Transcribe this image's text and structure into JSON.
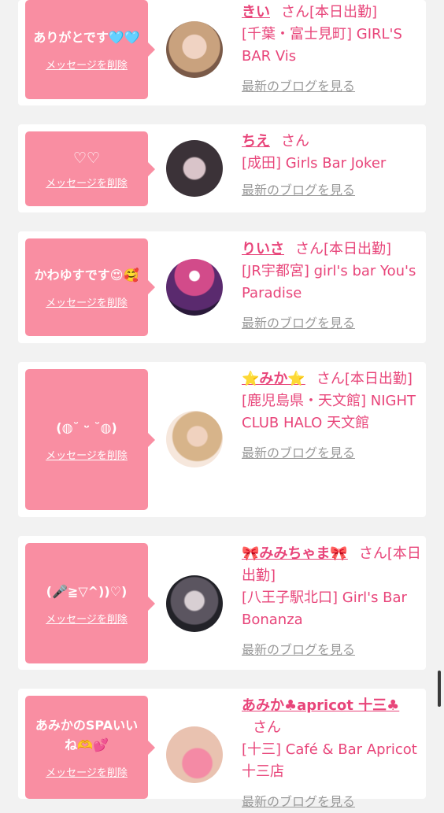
{
  "cards": [
    {
      "message": "ありがとです🩵🩵",
      "delete_label": "メッセージを削除",
      "name": "きい",
      "suffix": "さん[本日出勤]",
      "shop": "[千葉・富士見町] GIRL'S BAR Vis",
      "blog_label": "最新のブログを見る",
      "avatar_colors": [
        "#c9a27e",
        "#7a5a48"
      ]
    },
    {
      "message": "♡♡",
      "delete_label": "メッセージを削除",
      "name": "ちえ",
      "suffix": "さん",
      "shop": "[成田] Girls Bar Joker",
      "blog_label": "最新のブログを見る",
      "avatar_colors": [
        "#3b3238",
        "#c9b8bd"
      ]
    },
    {
      "message": "かわゆすです😍🥰",
      "delete_label": "メッセージを削除",
      "name": "りいさ",
      "suffix": "さん[本日出勤]",
      "shop": "[JR宇都宮] girl's bar You's Paradise",
      "blog_label": "最新のブログを見る",
      "avatar_colors": [
        "#5a2a6e",
        "#d24b8a"
      ]
    },
    {
      "message": "(◍˘ ᵕ ˘◍)",
      "delete_label": "メッセージを削除",
      "name": "⭐️みか⭐️",
      "suffix": "さん[本日出勤]",
      "shop": "[鹿児島県・天文館] NIGHT CLUB HALO 天文館",
      "blog_label": "最新のブログを見る",
      "avatar_colors": [
        "#d7b48a",
        "#f6e7dc"
      ]
    },
    {
      "message": "(🎤≧▽^))♡)",
      "delete_label": "メッセージを削除",
      "name": "🎀みみちゃま🎀",
      "suffix": "さん[本日出勤]",
      "shop": "[八王子駅北口] Girl's Bar Bonanza",
      "blog_label": "最新のブログを見る",
      "avatar_colors": [
        "#222228",
        "#c9c3c8"
      ]
    },
    {
      "message": "あみかのSPAいいね🫶💕",
      "delete_label": "メッセージを削除",
      "name": "あみか♣apricot 十三♣",
      "suffix": "さん",
      "shop": "[十三] Café & Bar Apricot 十三店",
      "blog_label": "最新のブログを見る",
      "avatar_colors": [
        "#e9c2b0",
        "#f48aa5"
      ]
    }
  ]
}
